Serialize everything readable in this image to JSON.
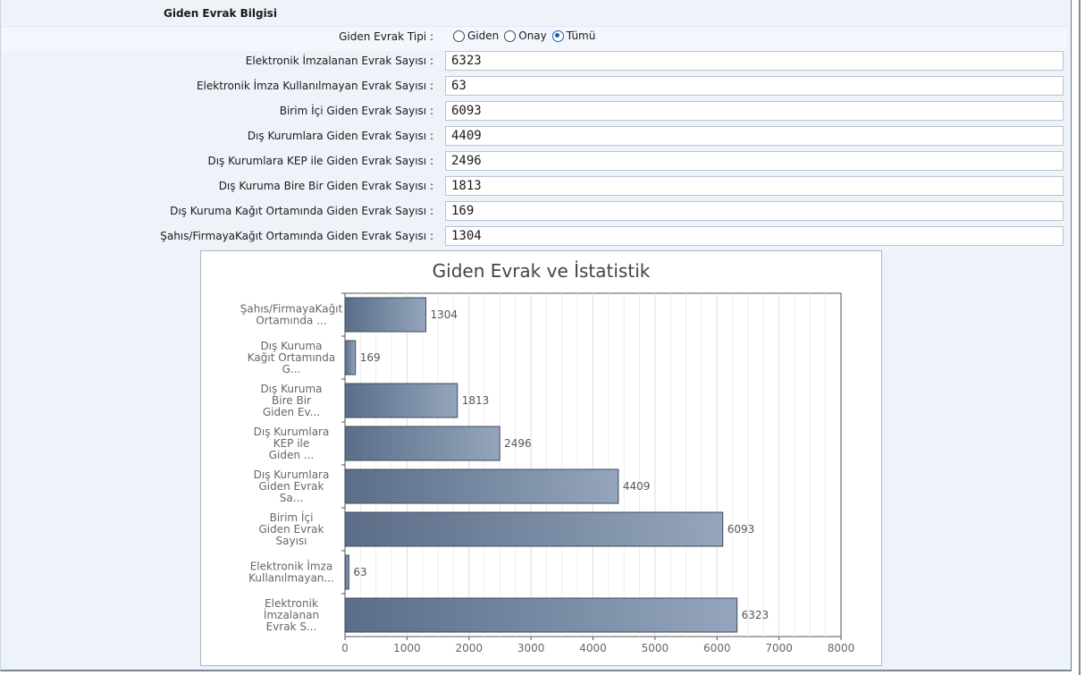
{
  "section_title": "Giden Evrak Bilgisi",
  "type_row": {
    "label": "Giden Evrak Tipi :",
    "options": [
      "Giden",
      "Onay",
      "Tümü"
    ],
    "selected": "Tümü"
  },
  "fields": [
    {
      "label": "Elektronik İmzalanan Evrak Sayısı :",
      "value": "6323"
    },
    {
      "label": "Elektronik İmza Kullanılmayan Evrak Sayısı :",
      "value": "63"
    },
    {
      "label": "Birim İçi Giden Evrak Sayısı :",
      "value": "6093"
    },
    {
      "label": "Dış Kurumlara Giden Evrak Sayısı :",
      "value": "4409"
    },
    {
      "label": "Dış Kurumlara KEP ile Giden Evrak Sayısı :",
      "value": "2496"
    },
    {
      "label": "Dış Kuruma Bire Bir Giden Evrak Sayısı :",
      "value": "1813"
    },
    {
      "label": "Dış Kuruma Kağıt Ortamında Giden Evrak Sayısı :",
      "value": "169"
    },
    {
      "label": "Şahıs/FirmayaKağıt Ortamında Giden Evrak Sayısı :",
      "value": "1304"
    }
  ],
  "chart_data": {
    "type": "bar",
    "orientation": "horizontal",
    "title": "Giden Evrak ve İstatistik",
    "categories": [
      [
        "Şahıs/FirmayaKağıt",
        "Ortamında ..."
      ],
      [
        "Dış Kuruma",
        "Kağıt Ortamında",
        "G..."
      ],
      [
        "Dış Kuruma",
        "Bire Bir",
        "Giden Ev..."
      ],
      [
        "Dış Kurumlara",
        "KEP ile",
        "Giden ..."
      ],
      [
        "Dış Kurumlara",
        "Giden Evrak",
        "Sa..."
      ],
      [
        "Birim İçi",
        "Giden Evrak",
        "Sayısı"
      ],
      [
        "Elektronik İmza",
        "Kullanılmayan..."
      ],
      [
        "Elektronik",
        "İmzalanan",
        "Evrak S..."
      ]
    ],
    "values": [
      1304,
      169,
      1813,
      2496,
      4409,
      6093,
      63,
      6323
    ],
    "xlim": [
      0,
      8000
    ],
    "xticks": [
      0,
      1000,
      2000,
      3000,
      4000,
      5000,
      6000,
      7000,
      8000
    ],
    "grid": true,
    "bar_color_start": "#5b6d87",
    "bar_color_end": "#94a5bd"
  }
}
